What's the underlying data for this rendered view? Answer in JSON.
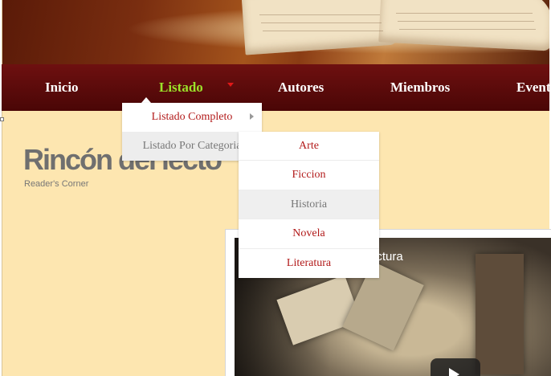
{
  "nav": {
    "items": [
      {
        "label": "Inicio"
      },
      {
        "label": "Listado"
      },
      {
        "label": "Autores"
      },
      {
        "label": "Miembros"
      },
      {
        "label": "Event"
      }
    ],
    "active_color": "#9be22a",
    "caret_color": "#e01818"
  },
  "dropdown": {
    "items": [
      {
        "label": "Listado Completo"
      },
      {
        "label": "Listado Por Categoria"
      }
    ]
  },
  "submenu": {
    "items": [
      {
        "label": "Arte"
      },
      {
        "label": "Ficcion"
      },
      {
        "label": "Historia"
      },
      {
        "label": "Novela"
      },
      {
        "label": "Literatura"
      }
    ]
  },
  "site": {
    "title": "Rincón del lecto",
    "subtitle": "Reader's Corner"
  },
  "video": {
    "title_fragment": "ectura"
  },
  "colors": {
    "background": "#fde6b0",
    "navbar": "#5c0a0a",
    "menu_link": "#b21a1a"
  }
}
